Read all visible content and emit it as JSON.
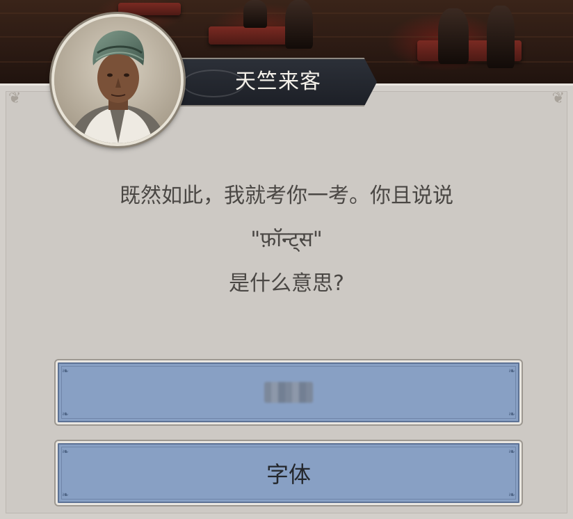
{
  "npc": {
    "name": "天竺来客",
    "portrait_icon": "turbaned-traveler-portrait"
  },
  "dialog": {
    "line1": "既然如此，我就考你一考。你且说说",
    "line2": "\"फ़ॉन्ट्स\"",
    "line3": "是什么意思?"
  },
  "answers": [
    {
      "label": "",
      "obscured": true
    },
    {
      "label": "字体",
      "obscured": false
    }
  ],
  "colors": {
    "panel": "#cdc9c4",
    "banner": "#1d2027",
    "answer_button": "#88a0c4",
    "dialog_text": "#4a4744"
  }
}
